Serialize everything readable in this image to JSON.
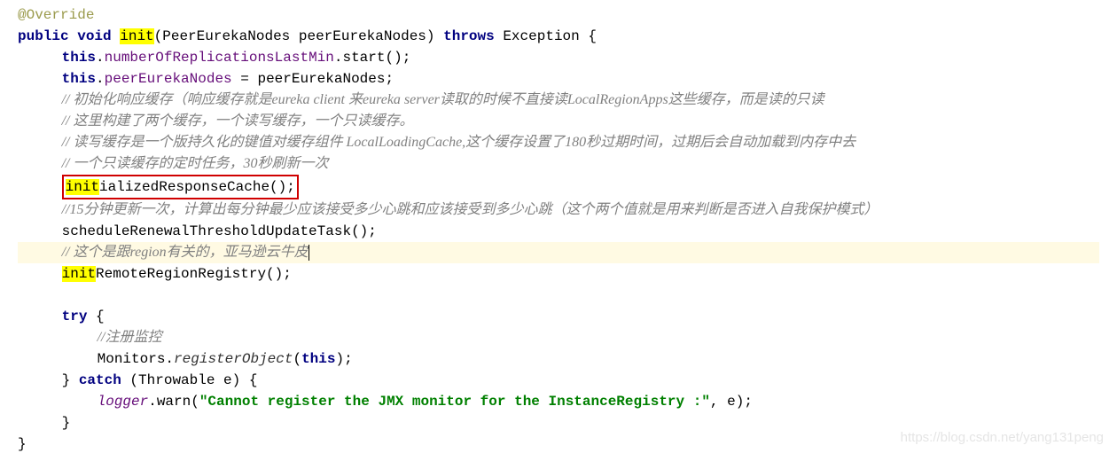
{
  "code": {
    "line1": {
      "annotation": "@Override"
    },
    "line2": {
      "kw1": "public",
      "kw2": "void",
      "method_hl": "init",
      "params": "(PeerEurekaNodes peerEurekaNodes)",
      "kw3": "throws",
      "exc": "Exception {"
    },
    "line3": {
      "this": "this",
      "dot1": ".",
      "field": "numberOfReplicationsLastMin",
      "dot2": ".start();"
    },
    "line4": {
      "this": "this",
      "dot1": ".",
      "field": "peerEurekaNodes",
      "rest": " = peerEurekaNodes;"
    },
    "comment1": "// 初始化响应缓存（响应缓存就是eureka client 来eureka server读取的时候不直接读LocalRegionApps这些缓存，而是读的只读",
    "comment2": "// 这里构建了两个缓存，一个读写缓存，一个只读缓存。",
    "comment3": "// 读写缓存是一个版持久化的键值对缓存组件 LocalLoadingCache,这个缓存设置了180秒过期时间，过期后会自动加载到内存中去",
    "comment4": "// 一个只读缓存的定时任务，30秒刷新一次",
    "line8": {
      "hl": "init",
      "rest": "ializedResponseCache();"
    },
    "comment5": "//15分钟更新一次，计算出每分钟最少应该接受多少心跳和应该接受到多少心跳（这个两个值就是用来判断是否进入自我保护模式）",
    "line10": "scheduleRenewalThresholdUpdateTask();",
    "comment6": "// 这个是跟region有关的，亚马逊云牛皮",
    "line12": {
      "hl": "init",
      "rest": "RemoteRegionRegistry();"
    },
    "try_kw": "try",
    "try_brace": " {",
    "comment7": "//注册监控",
    "line15": {
      "cls": "Monitors.",
      "method": "registerObject",
      "open": "(",
      "this": "this",
      "close": ");"
    },
    "catch_close": "} ",
    "catch_kw": "catch",
    "catch_params": " (Throwable e) {",
    "line17": {
      "logger": "logger",
      "method": ".warn(",
      "str": "\"Cannot register the JMX monitor for the InstanceRegistry :\"",
      "rest": ", e);"
    },
    "close_brace": "}",
    "final_brace": "}"
  },
  "watermark": "https://blog.csdn.net/yang131peng"
}
